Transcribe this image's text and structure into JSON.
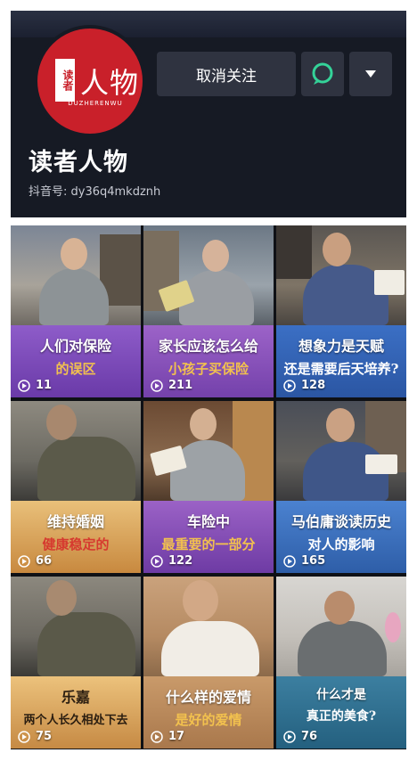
{
  "profile": {
    "avatar_logo_mark": "读者",
    "avatar_logo_title": "人物",
    "avatar_logo_sub": "DUZHERENWU",
    "name": "读者人物",
    "douyin_id": "抖音号: dy36q4mkdznh",
    "unfollow_label": "取消关注",
    "chat_icon": "chat-bubble-icon",
    "more_icon": "caret-down-icon"
  },
  "colors": {
    "header_bg": "#161a24",
    "button_bg": "#2f3340",
    "avatar_red": "#c9202a",
    "chat_green": "#34d399"
  },
  "videos": [
    {
      "caption1": "人们对保险",
      "caption2": "的误区",
      "plays": "11"
    },
    {
      "caption1": "家长应该怎么给",
      "caption2": "小孩子买保险",
      "plays": "211"
    },
    {
      "caption1": "想象力是天赋",
      "caption2": "还是需要后天培养?",
      "plays": "128"
    },
    {
      "caption1": "维持婚姻",
      "caption2": "健康稳定的",
      "plays": "66"
    },
    {
      "caption1": "车险中",
      "caption2": "最重要的一部分",
      "plays": "122"
    },
    {
      "caption1": "马伯庸谈读历史",
      "caption2": "对人的影响",
      "plays": "165"
    },
    {
      "caption1": "乐嘉",
      "caption2": "两个人长久相处下去",
      "plays": "75"
    },
    {
      "caption1": "什么样的爱情",
      "caption2": "是好的爱情",
      "plays": "17"
    },
    {
      "caption1": "什么才是",
      "caption2": "真正的美食?",
      "plays": "76"
    }
  ]
}
